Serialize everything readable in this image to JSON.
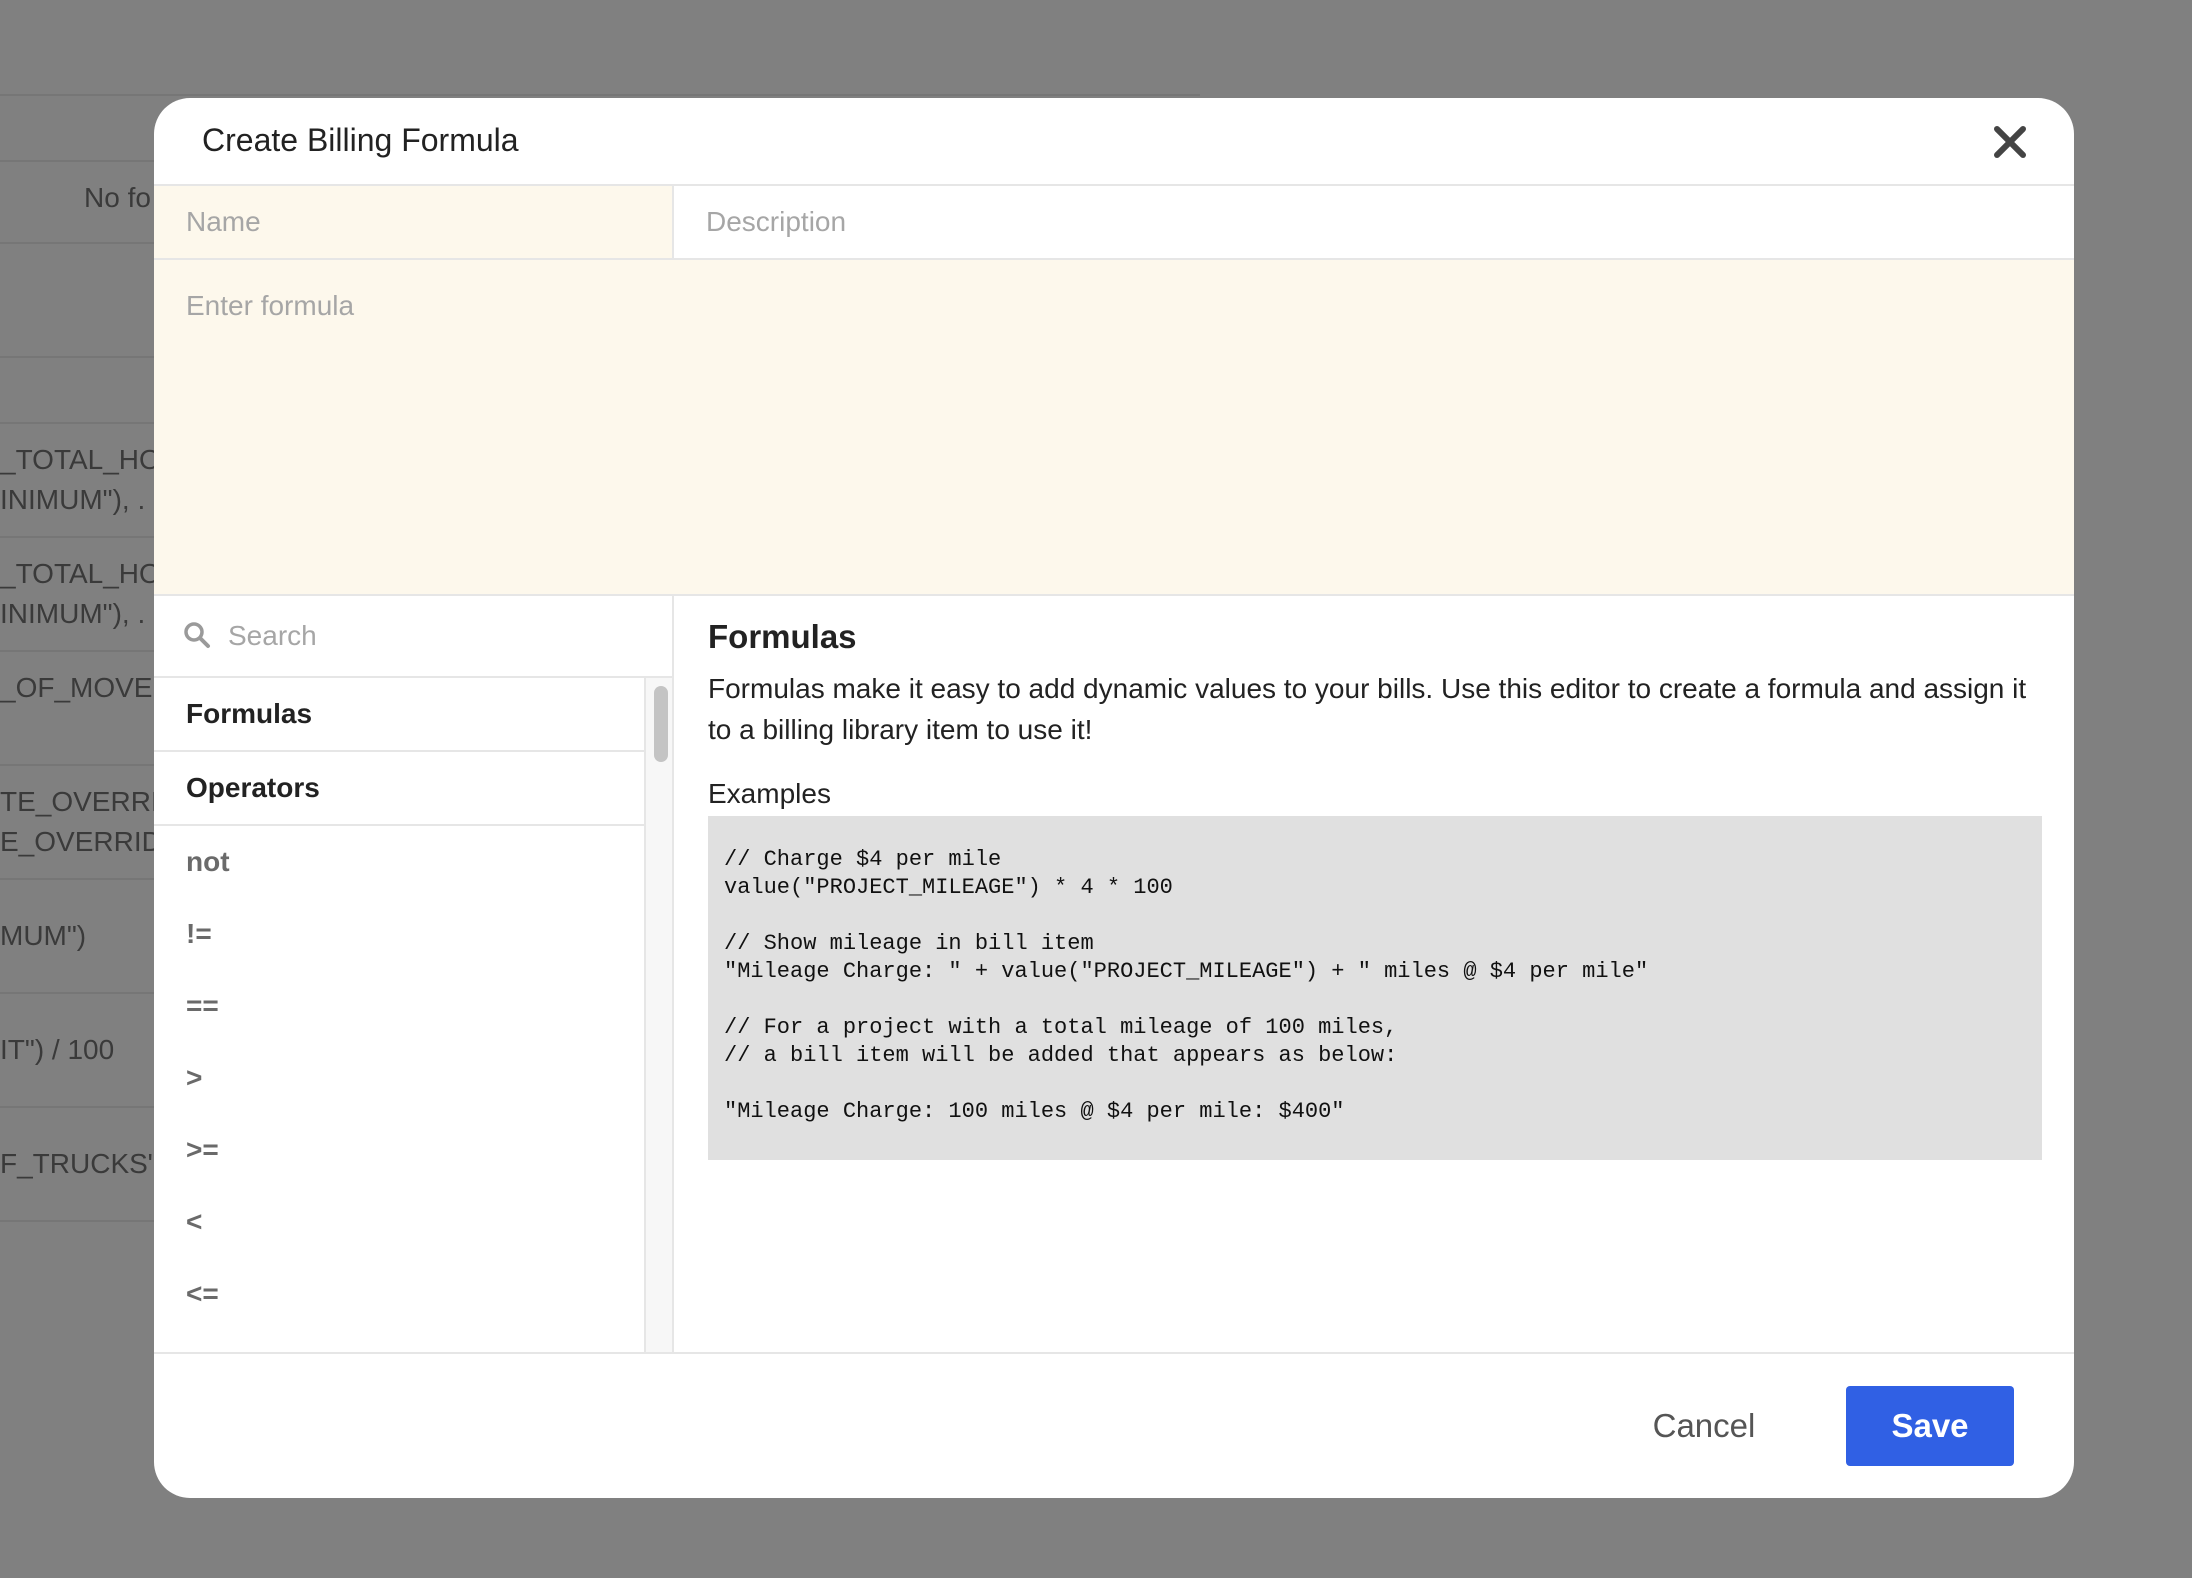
{
  "background": {
    "no_formulas_text": "No fo",
    "rows": [
      "_TOTAL_HO",
      "INIMUM\"), .",
      "_TOTAL_HO",
      "INIMUM\"), .",
      "_OF_MOVE",
      "TE_OVERRID",
      "E_OVERRIDE",
      "MUM\")",
      "IT\") / 100",
      "F_TRUCKS\")"
    ]
  },
  "modal": {
    "title": "Create Billing Formula",
    "close_icon": "close-icon",
    "name_placeholder": "Name",
    "name_value": "",
    "description_placeholder": "Description",
    "description_value": "",
    "formula_placeholder": "Enter formula",
    "formula_value": ""
  },
  "sidebar": {
    "search_placeholder": "Search",
    "search_icon": "search-icon",
    "sections": [
      {
        "label": "Formulas"
      },
      {
        "label": "Operators"
      }
    ],
    "operators": [
      "not",
      "!=",
      "==",
      ">",
      ">=",
      "<",
      "<="
    ]
  },
  "content": {
    "title": "Formulas",
    "description": "Formulas make it easy to add dynamic values to your bills. Use this editor to create a formula and assign it to a billing library item to use it!",
    "examples_label": "Examples",
    "code": "// Charge $4 per mile\nvalue(\"PROJECT_MILEAGE\") * 4 * 100\n\n// Show mileage in bill item\n\"Mileage Charge: \" + value(\"PROJECT_MILEAGE\") + \" miles @ $4 per mile\"\n\n// For a project with a total mileage of 100 miles,\n// a bill item will be added that appears as below:\n\n\"Mileage Charge: 100 miles @ $4 per mile: $400\""
  },
  "footer": {
    "cancel_label": "Cancel",
    "save_label": "Save"
  },
  "colors": {
    "accent": "#3060e4",
    "input_highlight": "#fdf8ec",
    "code_background": "#e0e0e0",
    "overlay": "#808080"
  }
}
